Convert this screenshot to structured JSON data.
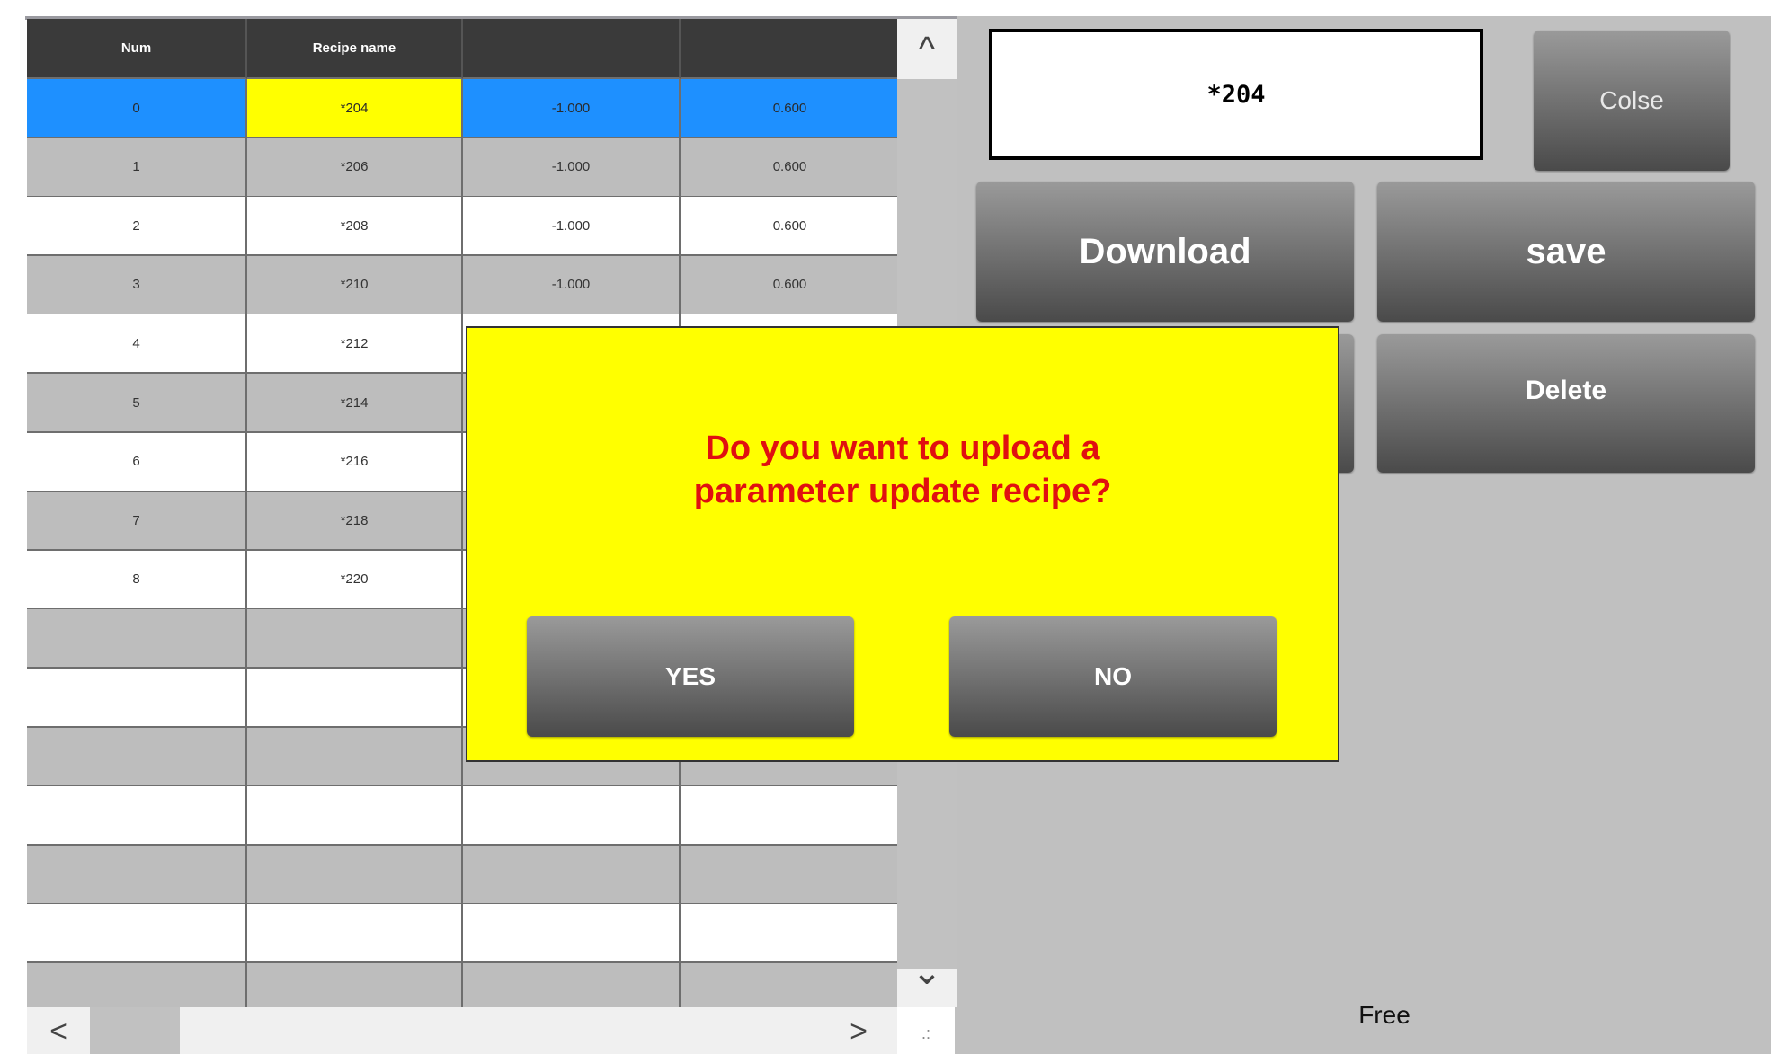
{
  "table": {
    "headers": [
      "Num",
      "Recipe name",
      "",
      ""
    ],
    "rows": [
      {
        "num": "0",
        "name": "*204",
        "v1": "-1.000",
        "v2": "0.600"
      },
      {
        "num": "1",
        "name": "*206",
        "v1": "-1.000",
        "v2": "0.600"
      },
      {
        "num": "2",
        "name": "*208",
        "v1": "-1.000",
        "v2": "0.600"
      },
      {
        "num": "3",
        "name": "*210",
        "v1": "-1.000",
        "v2": "0.600"
      },
      {
        "num": "4",
        "name": "*212",
        "v1": "",
        "v2": ""
      },
      {
        "num": "5",
        "name": "*214",
        "v1": "",
        "v2": ""
      },
      {
        "num": "6",
        "name": "*216",
        "v1": "",
        "v2": ""
      },
      {
        "num": "7",
        "name": "*218",
        "v1": "",
        "v2": ""
      },
      {
        "num": "8",
        "name": "*220",
        "v1": "",
        "v2": ""
      },
      {
        "num": "",
        "name": "",
        "v1": "",
        "v2": ""
      },
      {
        "num": "",
        "name": "",
        "v1": "",
        "v2": ""
      },
      {
        "num": "",
        "name": "",
        "v1": "",
        "v2": ""
      },
      {
        "num": "",
        "name": "",
        "v1": "",
        "v2": ""
      },
      {
        "num": "",
        "name": "",
        "v1": "",
        "v2": ""
      },
      {
        "num": "",
        "name": "",
        "v1": "",
        "v2": ""
      },
      {
        "num": "",
        "name": "",
        "v1": "",
        "v2": ""
      },
      {
        "num": "",
        "name": "",
        "v1": "",
        "v2": ""
      }
    ],
    "selected_row": 0
  },
  "scrollbars": {
    "up_glyph": "^",
    "down_glyph": "⌄",
    "left_glyph": "<",
    "right_glyph": ">",
    "grip_glyph": ".:"
  },
  "panel": {
    "current_recipe": "*204",
    "buttons": {
      "close": "Colse",
      "download": "Download",
      "save": "save",
      "delete": "Delete"
    },
    "status": "Free"
  },
  "dialog": {
    "message": "Do you want to upload a\nparameter update recipe?",
    "yes": "YES",
    "no": "NO"
  },
  "colors": {
    "selected_row": "#1e90ff",
    "selected_name": "#ffff00",
    "dialog_bg": "#ffff00",
    "dialog_text": "#e01010",
    "panel_bg": "#c0c0c0",
    "header_bg": "#3a3a3a"
  }
}
